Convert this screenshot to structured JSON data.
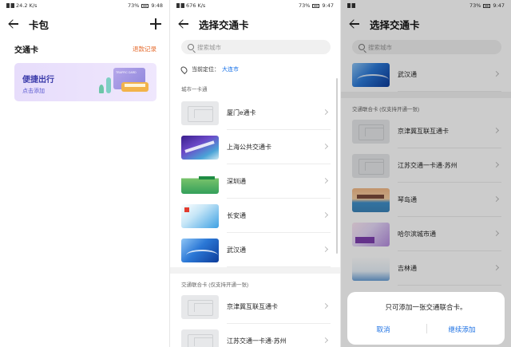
{
  "panel1": {
    "status": {
      "left": "24.2 K/s",
      "battery": "73%",
      "time": "9:48"
    },
    "title": "卡包",
    "section_title": "交通卡",
    "refund_link": "退款记录",
    "banner": {
      "title": "便捷出行",
      "subtitle": "点击添加",
      "card_text": "TRAFFIC CARD"
    }
  },
  "panel2": {
    "status": {
      "left": "676 K/s",
      "battery": "73%",
      "time": "9:47"
    },
    "title": "选择交通卡",
    "search_placeholder": "搜索城市",
    "location_label": "当前定位：",
    "location_city": "大连市",
    "city_section": "城市一卡通",
    "city_cards": [
      {
        "name": "厦门e通卡",
        "thumb": "th-gray"
      },
      {
        "name": "上海公共交通卡",
        "thumb": "th-shanghai"
      },
      {
        "name": "深圳通",
        "thumb": "th-shenzhen"
      },
      {
        "name": "长安通",
        "thumb": "th-changan"
      },
      {
        "name": "武汉通",
        "thumb": "th-wuhan"
      }
    ],
    "union_section": "交通联合卡 (仅支持开通一张)",
    "union_cards": [
      {
        "name": "京津冀互联互通卡",
        "thumb": "th-gray"
      },
      {
        "name": "江苏交通一卡通·苏州",
        "thumb": "th-gray"
      }
    ]
  },
  "panel3": {
    "status": {
      "battery": "73%",
      "time": "9:47"
    },
    "title": "选择交通卡",
    "search_placeholder": "搜索城市",
    "top_cards": [
      {
        "name": "武汉通",
        "thumb": "th-wuhan"
      }
    ],
    "union_section": "交通联合卡 (仅支持开通一张)",
    "union_cards": [
      {
        "name": "京津冀互联互通卡",
        "thumb": "th-gray"
      },
      {
        "name": "江苏交通一卡通·苏州",
        "thumb": "th-gray"
      },
      {
        "name": "琴岛通",
        "thumb": "th-qingdao"
      },
      {
        "name": "哈尔滨城市通",
        "thumb": "th-harbin"
      },
      {
        "name": "吉林通",
        "thumb": "th-jilin"
      }
    ],
    "dialog": {
      "message": "只可添加一张交通联合卡。",
      "cancel": "取消",
      "confirm": "继续添加"
    }
  }
}
